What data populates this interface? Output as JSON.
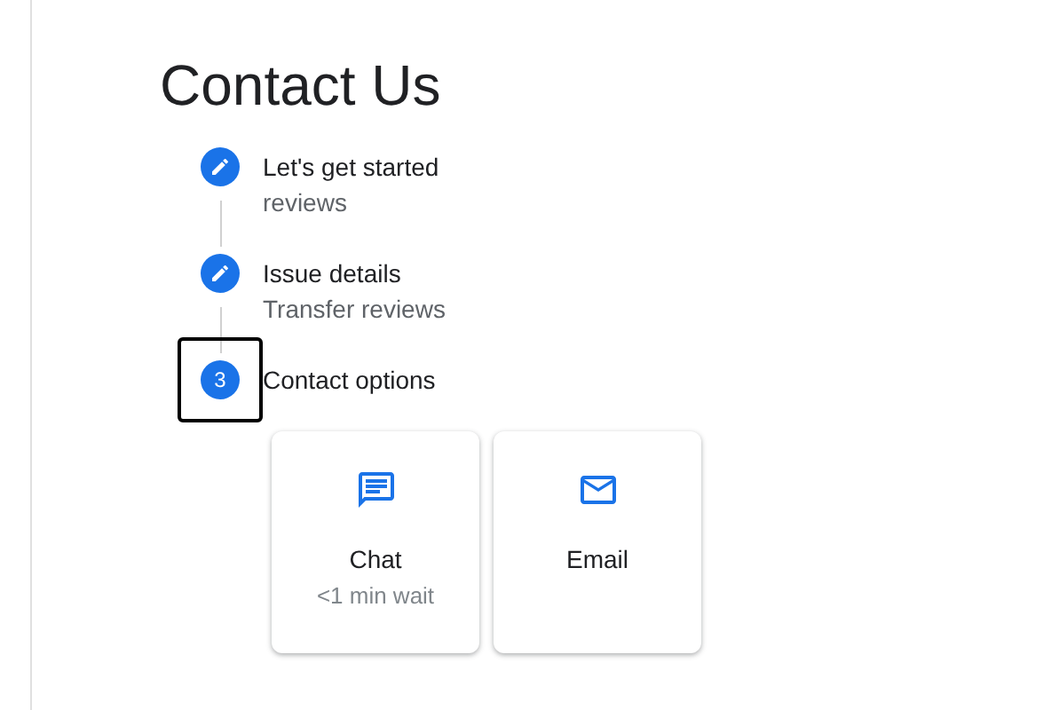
{
  "title": "Contact Us",
  "steps": [
    {
      "kind": "edit",
      "label": "Let's get started",
      "summary": "reviews",
      "focused": false
    },
    {
      "kind": "edit",
      "label": "Issue details",
      "summary": "Transfer reviews",
      "focused": false
    },
    {
      "kind": "number",
      "number": "3",
      "label": "Contact options",
      "focused": true
    }
  ],
  "options": [
    {
      "kind": "chat",
      "label": "Chat",
      "detail": "<1 min wait"
    },
    {
      "kind": "email",
      "label": "Email"
    }
  ]
}
